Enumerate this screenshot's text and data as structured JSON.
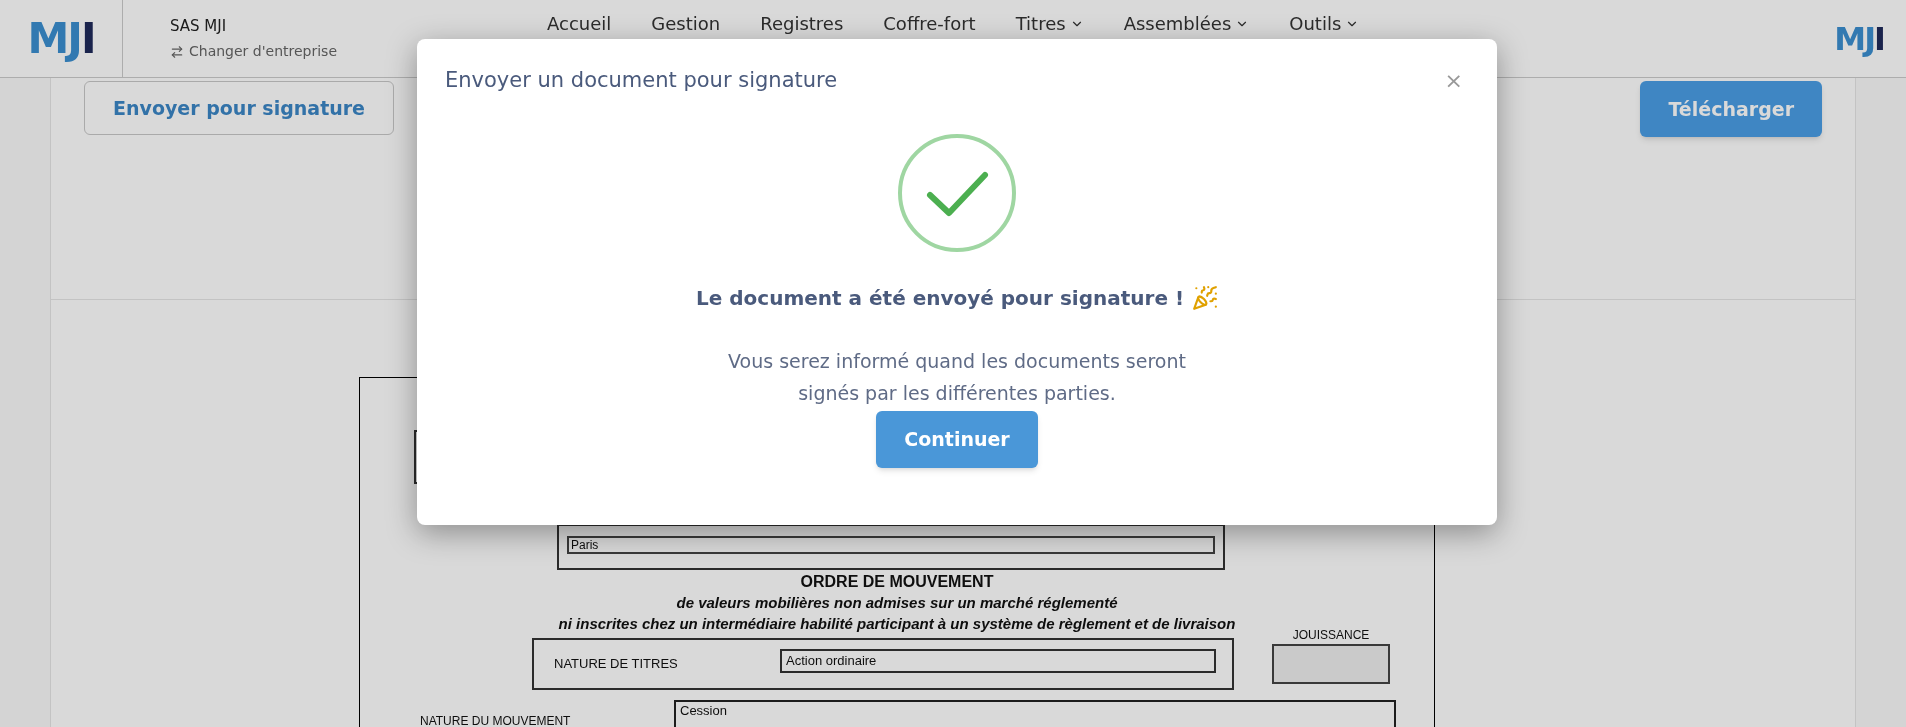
{
  "header": {
    "logo": "MJI",
    "company": "SAS MJI",
    "switch_link": "Changer d'entreprise",
    "nav": [
      {
        "label": "Accueil",
        "dropdown": false
      },
      {
        "label": "Gestion",
        "dropdown": false
      },
      {
        "label": "Registres",
        "dropdown": false
      },
      {
        "label": "Coffre-fort",
        "dropdown": false
      },
      {
        "label": "Titres",
        "dropdown": true
      },
      {
        "label": "Assemblées",
        "dropdown": true
      },
      {
        "label": "Outils",
        "dropdown": true
      }
    ],
    "logo_right": "MJI"
  },
  "toolbar": {
    "send_button": "Envoyer pour signature",
    "download_button": "Télécharger"
  },
  "document": {
    "city": "Paris",
    "title": "ORDRE DE MOUVEMENT",
    "subtitle_lines": [
      "de valeurs mobilières non admises sur un marché réglementé",
      "ni inscrites chez un intermédiaire habilité participant à un système de règlement et de livraison"
    ],
    "securities_label": "NATURE DE TITRES",
    "securities_value": "Action ordinaire",
    "enjoyment_label": "JOUISSANCE",
    "movement_label": "NATURE DU MOUVEMENT",
    "movement_value": "Cession"
  },
  "modal": {
    "title": "Envoyer un document pour signature",
    "close": "×",
    "heading": "Le document a été envoyé pour signature !",
    "message": "Vous serez informé quand les documents seront signés par les différentes parties.",
    "button": "Continuer"
  }
}
